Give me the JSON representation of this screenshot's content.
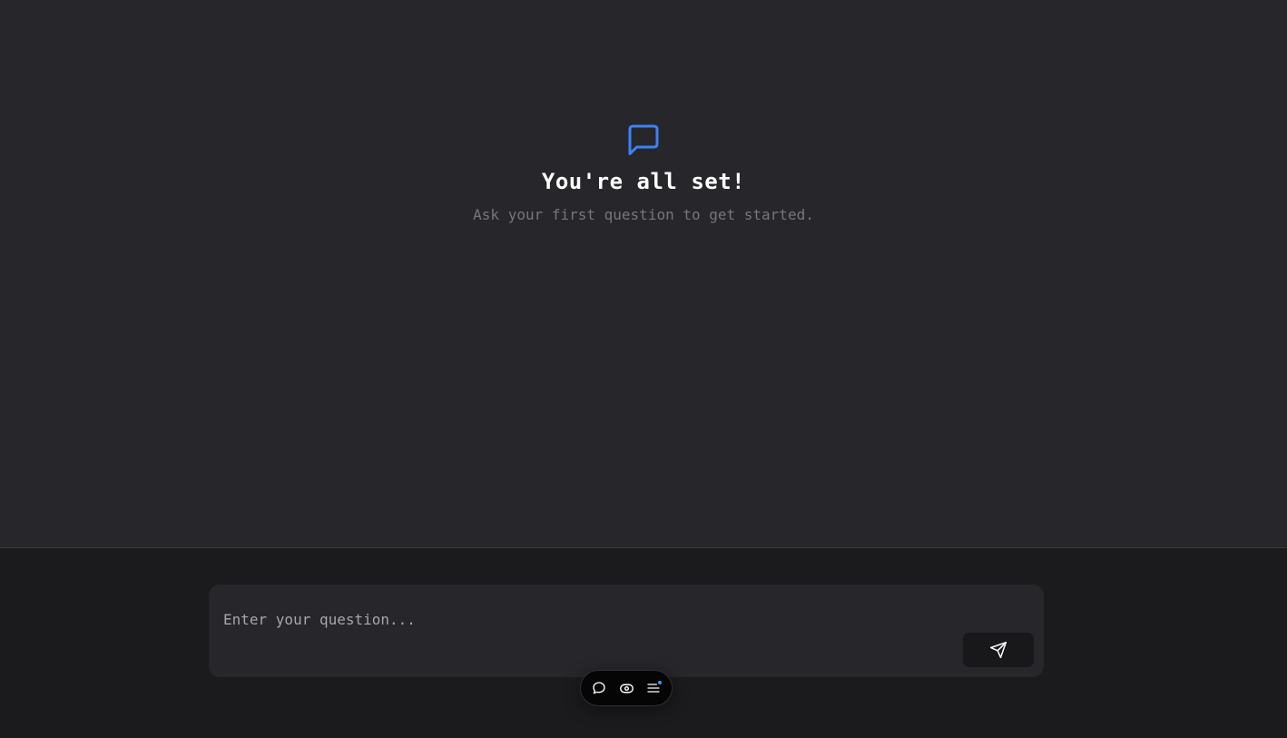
{
  "empty_state": {
    "icon": "message-square-icon",
    "title": "You're all set!",
    "subtitle": "Ask your first question to get started."
  },
  "composer": {
    "placeholder": "Enter your question...",
    "value": "",
    "send_icon": "send-icon"
  },
  "toolbar": {
    "items": [
      {
        "icon": "chat-bubble-icon"
      },
      {
        "icon": "eye-icon"
      },
      {
        "icon": "menu-icon",
        "has_notification": true
      }
    ]
  },
  "colors": {
    "accent": "#3b82f6",
    "main_background": "#27262b",
    "footer_background": "#1b1b1e",
    "toolbar_background": "#050506"
  }
}
